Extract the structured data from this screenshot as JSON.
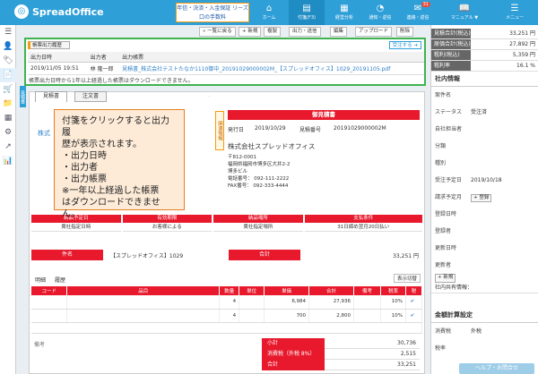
{
  "app": {
    "logo_text": "SpreadOffice",
    "banner_text": "年信・決済・入金保証 リーズ口の手数料",
    "help_button": "ヘルプ・お問合せ"
  },
  "sidebar": {
    "title": "メニュー"
  },
  "nav": [
    {
      "label": "ホーム",
      "icon": "home-icon"
    },
    {
      "label": "付箋(F3)",
      "icon": "sticky-note-icon"
    },
    {
      "label": "経営分析",
      "icon": "dashboard-icon"
    },
    {
      "label": "通知・返信",
      "icon": "bell-icon"
    },
    {
      "label": "連絡・返信",
      "icon": "mail-icon",
      "badge": "31"
    },
    {
      "label": "マニュアル ▼",
      "icon": "book-icon"
    },
    {
      "label": "メニュー",
      "icon": "menu-icon"
    }
  ],
  "toolbar": {
    "back": "« 一覧に戻る",
    "new": "+ 新規",
    "copy": "複製",
    "print": "出力・送信",
    "edit": "編集",
    "upload": "アップロード",
    "delete": "削除"
  },
  "history": {
    "tab_label": "帳票出力履歴",
    "receive_button": "受注する ➜",
    "columns": [
      "出力日時",
      "出力者",
      "出力帳票"
    ],
    "rows": [
      {
        "datetime": "2019/11/05 19:51",
        "user": "林 隆一郎",
        "file": "見積書_株式会社テストたなか1110御中_20191029000002M_【スプレッドオフィス】1029_20191105.pdf"
      }
    ],
    "note": "帳票出力日時から1年以上経過した帳票はダウンロードできません。"
  },
  "doc_tabs": [
    "見積書",
    "注文書"
  ],
  "left_tab": "見積書",
  "callout": {
    "lines": [
      "付箋をクリックすると出力履",
      "歴が表示されます。",
      "・出力日時",
      "・出力者",
      "・出力帳票",
      "※一年以上経過した帳票",
      "はダウンロードできません。"
    ]
  },
  "side_tag": "関連情報",
  "document": {
    "title": "御見積書",
    "issue_label": "発行日",
    "issue_date": "2019/10/29",
    "number_label": "見積番号",
    "number": "20191029000002M",
    "customer": "株式",
    "issuer_name": "株式会社スプレッドオフィス",
    "issuer_lines": [
      "〒812-0001",
      "福岡県福岡市博多区大井2-2",
      "博多ビル",
      "電話番号： 092-111-2222",
      "FAX番号： 092-333-4444"
    ],
    "terms_headers": [
      "納品予定日",
      "有効期限",
      "納品場所",
      "支払条件"
    ],
    "terms_values": [
      "貴社指定日時",
      "お客様による",
      "貴社指定場所",
      "31日締め翌月20日払い"
    ],
    "subject_label": "件名",
    "subject": "【スプレッドオフィス】1029",
    "total_label": "合計",
    "total": "33,251 円",
    "detail_tabs": [
      "明細",
      "履歴"
    ],
    "display_toggle": "表示切替",
    "item_columns": [
      "コード",
      "品目",
      "数量",
      "単位",
      "単価",
      "合計",
      "備考",
      "税率",
      "税"
    ],
    "items": [
      {
        "qty": "4",
        "price": "6,984",
        "total": "27,936",
        "tax": "10%"
      },
      {
        "qty": "4",
        "price": "700",
        "total": "2,800",
        "tax": "10%"
      }
    ],
    "remarks_label": "備考",
    "totals": [
      {
        "label": "小計",
        "value": "30,736"
      },
      {
        "label": "消費税（外税 8%）",
        "value": "2,515"
      },
      {
        "label": "合計",
        "value": "33,251"
      }
    ]
  },
  "summary": [
    {
      "label": "見積合計(税込)",
      "value": "33,251 円"
    },
    {
      "label": "原価合計(税込)",
      "value": "27,892 円"
    },
    {
      "label": "粗利(税込)",
      "value": "5,359 円"
    },
    {
      "label": "粗利率",
      "value": "16.1 %"
    }
  ],
  "company_info": {
    "title": "社内情報",
    "rows": [
      {
        "label": "案件名",
        "value": ""
      },
      {
        "label": "ステータス",
        "value": "受注済"
      },
      {
        "label": "自社担当者",
        "value": ""
      },
      {
        "label": "分類",
        "value": ""
      },
      {
        "label": "種別",
        "value": ""
      },
      {
        "label": "受注予定日",
        "value": "2019/10/18"
      },
      {
        "label": "請求予定月",
        "value": ""
      },
      {
        "label": "登録日時",
        "value": ""
      },
      {
        "label": "登録者",
        "value": ""
      },
      {
        "label": "更新日時",
        "value": ""
      },
      {
        "label": "更新者",
        "value": ""
      }
    ],
    "add_label": "登録",
    "add_label2": "新規",
    "note": "社内共有情報："
  },
  "tax_settings": {
    "title": "金額計算設定",
    "rows": [
      {
        "label": "消費税",
        "value": "外税"
      },
      {
        "label": "税率",
        "value": ""
      }
    ]
  },
  "colors": {
    "brand": "#2f9fd8",
    "accent_red": "#e8192c",
    "history_border": "#3fb34f",
    "callout_border": "#e67e22"
  }
}
